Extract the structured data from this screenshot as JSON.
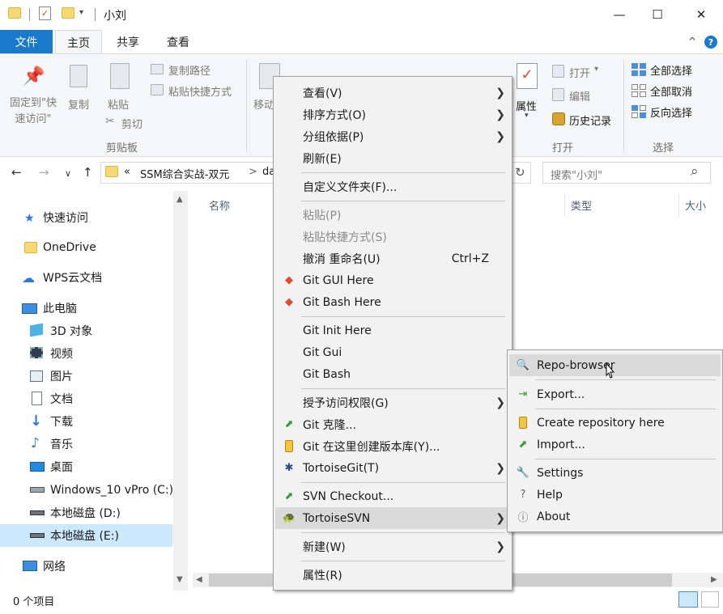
{
  "window": {
    "title": "小刘",
    "qat_dropdown": "▾",
    "minimize": "—",
    "maximize": "☐",
    "close": "✕"
  },
  "ribbon_tabs": {
    "file": "文件",
    "home": "主页",
    "share": "共享",
    "view": "查看",
    "help": "?",
    "expand": "^"
  },
  "ribbon": {
    "pin_quick_access": "固定到\"快\n速访问\"",
    "pin_quick_access_l1": "固定到\"快",
    "pin_quick_access_l2": "速访问\"",
    "copy": "复制",
    "paste": "粘贴",
    "copy_path": "复制路径",
    "paste_shortcut": "粘贴快捷方式",
    "cut": "剪切",
    "clipboard_group": "剪贴板",
    "move_to": "移动",
    "properties": "属性",
    "open": "打开",
    "open_dropdown": "▾",
    "edit": "编辑",
    "history": "历史记录",
    "open_group": "打开",
    "select_all": "全部选择",
    "select_none": "全部取消",
    "invert_selection": "反向选择",
    "select_group": "选择"
  },
  "address_bar": {
    "prefix": "«",
    "path_text": "SSM综合实战-双元",
    "sep": ">",
    "tail": "da",
    "refresh": "↻"
  },
  "search": {
    "placeholder": "搜索\"小刘\""
  },
  "nav_pane": {
    "items": [
      {
        "label": "快速访问"
      },
      {
        "label": "OneDrive"
      },
      {
        "label": "WPS云文档"
      },
      {
        "label": "此电脑"
      },
      {
        "label": "3D 对象"
      },
      {
        "label": "视频"
      },
      {
        "label": "图片"
      },
      {
        "label": "文档"
      },
      {
        "label": "下载"
      },
      {
        "label": "音乐"
      },
      {
        "label": "桌面"
      },
      {
        "label": "Windows_10 vPro (C:)"
      },
      {
        "label": "本地磁盘 (D:)"
      },
      {
        "label": "本地磁盘 (E:)"
      },
      {
        "label": "网络"
      }
    ]
  },
  "columns": {
    "name": "名称",
    "type": "类型",
    "size": "大小"
  },
  "status_bar": {
    "item_count": "0 个项目"
  },
  "context_menu": {
    "items": [
      {
        "label": "查看(V)",
        "submenu": true
      },
      {
        "label": "排序方式(O)",
        "submenu": true
      },
      {
        "label": "分组依据(P)",
        "submenu": true
      },
      {
        "label": "刷新(E)"
      },
      {
        "label": "自定义文件夹(F)..."
      },
      {
        "label": "粘贴(P)",
        "disabled": true
      },
      {
        "label": "粘贴快捷方式(S)",
        "disabled": true
      },
      {
        "label": "撤消 重命名(U)",
        "shortcut": "Ctrl+Z"
      },
      {
        "label": "Git GUI Here"
      },
      {
        "label": "Git Bash Here"
      },
      {
        "label": "Git Init Here"
      },
      {
        "label": "Git Gui"
      },
      {
        "label": "Git Bash"
      },
      {
        "label": "授予访问权限(G)",
        "submenu": true
      },
      {
        "label": "Git 克隆..."
      },
      {
        "label": "Git 在这里创建版本库(Y)..."
      },
      {
        "label": "TortoiseGit(T)",
        "submenu": true
      },
      {
        "label": "SVN Checkout..."
      },
      {
        "label": "TortoiseSVN",
        "submenu": true
      },
      {
        "label": "新建(W)",
        "submenu": true
      },
      {
        "label": "属性(R)"
      }
    ],
    "arrow": "❯"
  },
  "svn_submenu": {
    "items": [
      {
        "label": "Repo-browser"
      },
      {
        "label": "Export..."
      },
      {
        "label": "Create repository here"
      },
      {
        "label": "Import..."
      },
      {
        "label": "Settings"
      },
      {
        "label": "Help"
      },
      {
        "label": "About"
      }
    ]
  },
  "icons": {
    "back": "←",
    "forward": "→",
    "recent": "∨",
    "up": "↑",
    "search": "⌕",
    "dropdown": "∨"
  },
  "colors": {
    "accent": "#1979ca",
    "selection": "#cce8ff",
    "menu_bg": "#f2f2f2",
    "menu_hover": "#dadada"
  }
}
